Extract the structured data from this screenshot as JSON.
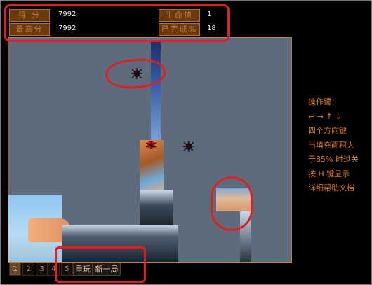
{
  "hud": {
    "score_label": "得 分",
    "score_value": "7992",
    "best_label": "最高分",
    "best_value": "7992",
    "lives_label": "生命值",
    "lives_value": "1",
    "done_label": "已完成%",
    "done_value": "18"
  },
  "help": {
    "title": "操作键：",
    "arrows": "← → ↑ ↓",
    "lines": [
      "四个方向键",
      "当填充面积大",
      "于85% 时过关",
      "按 H 键显示",
      "详细帮助文档"
    ]
  },
  "levels": [
    "1",
    "2",
    "3",
    "4",
    "5"
  ],
  "active_level": "1",
  "actions": {
    "replay": "重玩",
    "new_game": "新一局"
  },
  "colors": {
    "background": "#000000",
    "board": "#5d6b7d",
    "hud_label": "#6b3a0c",
    "accent": "#d97a30",
    "annotation": "#e02020"
  },
  "icons": {
    "enemy": "spider-icon",
    "player": "ladybug-icon"
  }
}
